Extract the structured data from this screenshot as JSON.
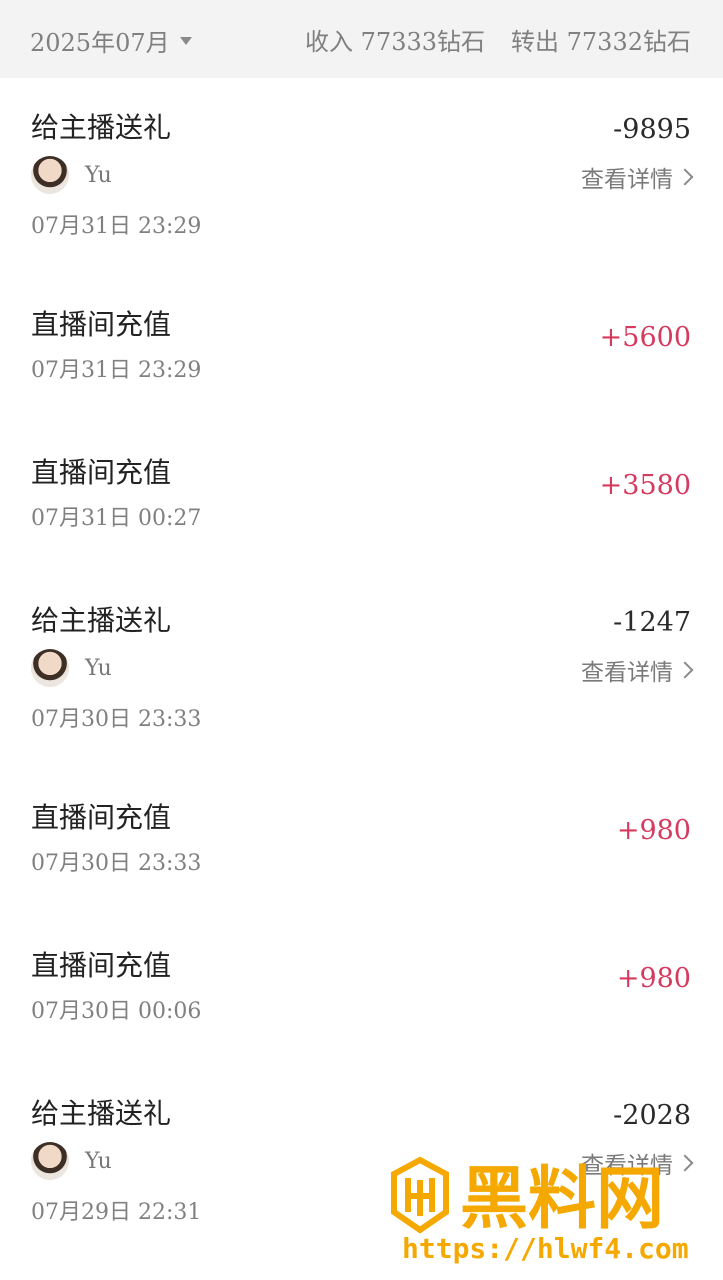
{
  "header": {
    "month": "2025年07月",
    "income": "收入 77333钻石",
    "outgo": "转出 77332钻石"
  },
  "list": [
    {
      "type": "gift",
      "title": "给主播送礼",
      "amount": "-9895",
      "user": "Yu",
      "detail": "查看详情",
      "time": "07月31日 23:29"
    },
    {
      "type": "recharge",
      "title": "直播间充值",
      "amount": "+5600",
      "time": "07月31日 23:29"
    },
    {
      "type": "recharge",
      "title": "直播间充值",
      "amount": "+3580",
      "time": "07月31日 00:27"
    },
    {
      "type": "gift",
      "title": "给主播送礼",
      "amount": "-1247",
      "user": "Yu",
      "detail": "查看详情",
      "time": "07月30日 23:33"
    },
    {
      "type": "recharge",
      "title": "直播间充值",
      "amount": "+980",
      "time": "07月30日 23:33"
    },
    {
      "type": "recharge",
      "title": "直播间充值",
      "amount": "+980",
      "time": "07月30日 00:06"
    },
    {
      "type": "gift",
      "title": "给主播送礼",
      "amount": "-2028",
      "user": "Yu",
      "detail": "查看详情",
      "time": "07月29日 22:31"
    }
  ],
  "watermark": {
    "brand": "黑料网",
    "url": "https://hlwf4.com"
  },
  "colors": {
    "positive": "#d63a5e",
    "negative": "#2a2a2a",
    "header_bg": "#f3f3f3",
    "watermark": "#f5a800"
  }
}
